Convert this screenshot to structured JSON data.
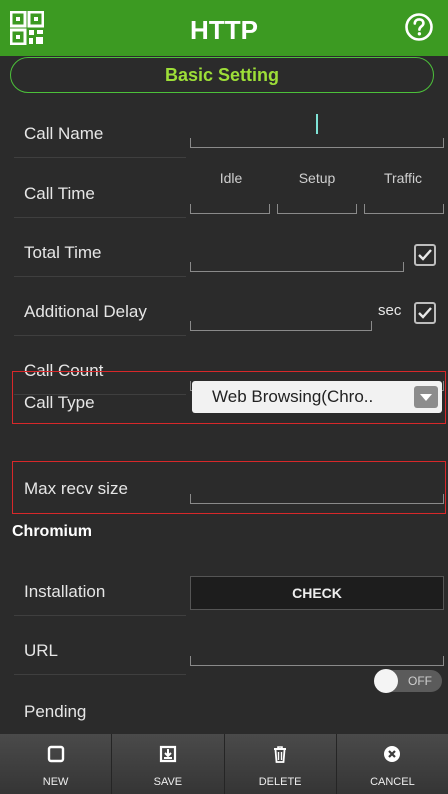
{
  "header": {
    "title": "HTTP"
  },
  "section": {
    "title": "Basic Setting"
  },
  "rows": {
    "call_name": "Call Name",
    "call_time": "Call Time",
    "total_time": "Total Time",
    "additional_delay": "Additional Delay",
    "call_count": "Call Count",
    "call_type": "Call Type",
    "max_recv": "Max recv size",
    "installation": "Installation",
    "url": "URL",
    "pending": "Pending"
  },
  "call_time_cols": {
    "idle": "Idle",
    "setup": "Setup",
    "traffic": "Traffic"
  },
  "delay_unit": "sec",
  "call_type_value": "Web Browsing(Chro..",
  "subsection": "Chromium",
  "check_button": "CHECK",
  "pending_toggle": "OFF",
  "bottom": {
    "new": "NEW",
    "save": "SAVE",
    "delete": "DELETE",
    "cancel": "CANCEL"
  },
  "colors": {
    "header": "#3c9a22",
    "accent": "#9dde38",
    "highlight": "#d8282a"
  }
}
